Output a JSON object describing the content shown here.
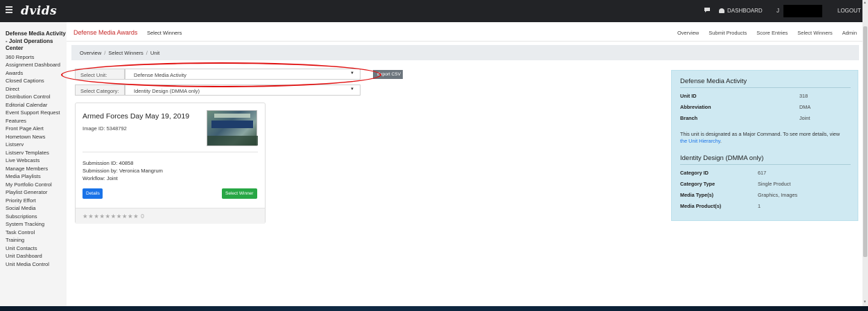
{
  "topbar": {
    "logo": "dvids",
    "dashboard": "DASHBOARD",
    "user_initial": "J",
    "logout": "LOGOUT",
    "icons": [
      "menu-icon",
      "chat-icon",
      "palette-icon"
    ]
  },
  "sidebar": {
    "title": "Defense Media Activity - Joint Operations Center",
    "items": [
      "360 Reports",
      "Assignment Dashboard",
      "Awards",
      "Closed Captions",
      "Direct",
      "Distribution Control",
      "Editorial Calendar",
      "Event Support Request",
      "Features",
      "Front Page Alert",
      "Hometown News",
      "Listserv",
      "Listserv Templates",
      "Live Webcasts",
      "Manage Members",
      "Media Playlists",
      "My Portfolio Control",
      "Playlist Generator",
      "Priority Effort",
      "Social Media",
      "Subscriptions",
      "System Tracking",
      "Task Control",
      "Training",
      "Unit Contacts",
      "Unit Dashboard",
      "Unit Media Control"
    ]
  },
  "header": {
    "title": "Defense Media Awards",
    "subtitle": "Select Winners",
    "nav": [
      "Overview",
      "Submit Products",
      "Score Entries",
      "Select Winners",
      "Admin"
    ]
  },
  "breadcrumb": [
    "Overview",
    "Select Winners",
    "Unit"
  ],
  "filters": {
    "unit_label": "Select Unit:",
    "unit_value": "Defense Media Activity",
    "category_label": "Select Category:",
    "category_value": "Identity Design (DMMA only)",
    "export_label": "Export CSV"
  },
  "card": {
    "title": "Armed Forces Day May 19, 2019",
    "image_id": "Image ID: 5348792",
    "submission_id": "Submission ID: 40858",
    "submission_by": "Submission by: Veronica Mangrum",
    "workflow": "Workflow: Joint",
    "details_label": "Details",
    "winner_label": "Select Winner",
    "stars": "★★★★★★★★★★",
    "score": "0"
  },
  "info": {
    "unit_heading": "Defense Media Activity",
    "unit_rows": [
      {
        "k": "Unit ID",
        "v": "318"
      },
      {
        "k": "Abbreviation",
        "v": "DMA"
      },
      {
        "k": "Branch",
        "v": "Joint"
      }
    ],
    "note": "This unit is designated as a Major Command. To see more details, view",
    "note_link": "the Unit Hierarchy",
    "category_heading": "Identity Design (DMMA only)",
    "category_rows": [
      {
        "k": "Category ID",
        "v": "617"
      },
      {
        "k": "Category Type",
        "v": "Single Product"
      },
      {
        "k": "Media Type(s)",
        "v": "Graphics, Images"
      },
      {
        "k": "Media Product(s)",
        "v": "1"
      }
    ]
  },
  "colors": {
    "topbar": "#222326",
    "accent_red": "#c62828",
    "details_blue": "#1a73e8",
    "winner_green": "#28a745",
    "info_bg": "#cfe9f2",
    "annotation_red": "#e01010"
  }
}
